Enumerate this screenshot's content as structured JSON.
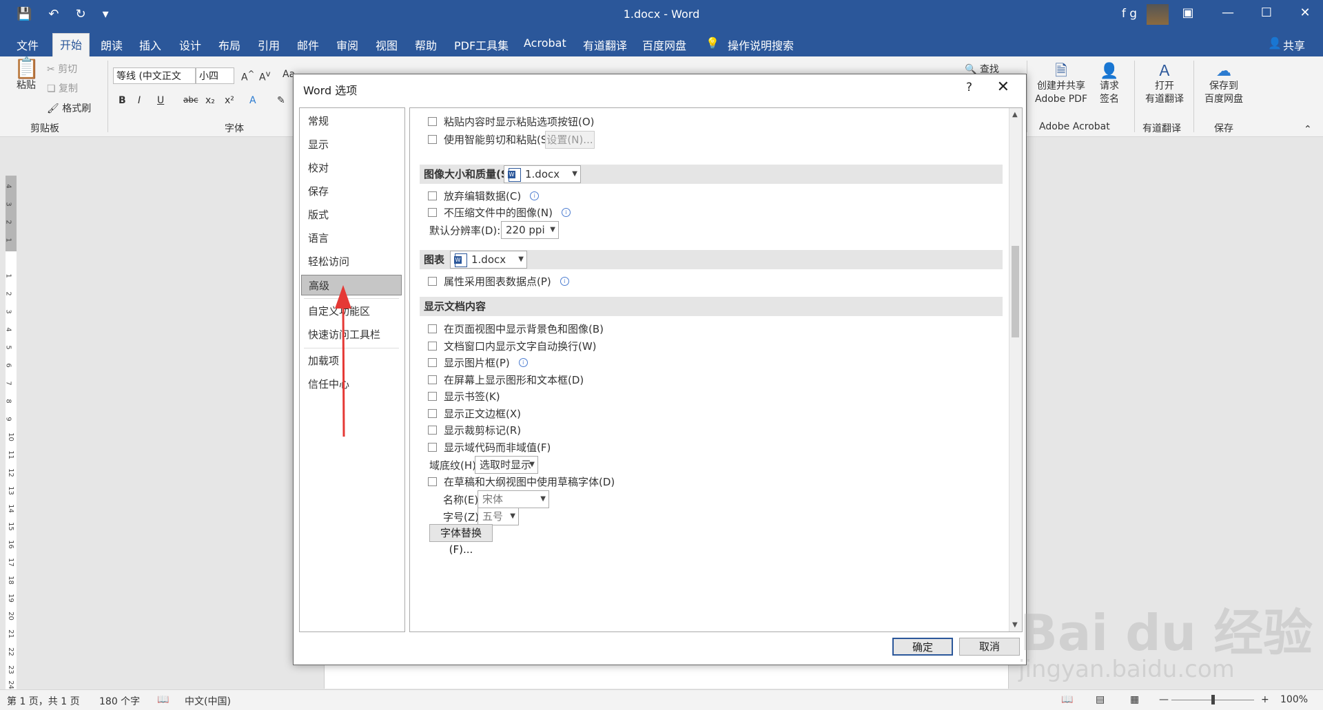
{
  "window": {
    "title": "1.docx - Word",
    "user": "f g"
  },
  "ribbon_tabs": [
    "文件",
    "开始",
    "朗读",
    "插入",
    "设计",
    "布局",
    "引用",
    "邮件",
    "审阅",
    "视图",
    "帮助",
    "PDF工具集",
    "Acrobat",
    "有道翻译",
    "百度网盘",
    "操作说明搜索",
    "共享"
  ],
  "ribbon": {
    "paste": "粘贴",
    "cut": "剪切",
    "copy": "复制",
    "format_painter": "格式刷",
    "clipboard_group": "剪贴板",
    "font_group": "字体",
    "font_name": "等线 (中文正文",
    "font_size": "小四",
    "find": "查找",
    "create_share": "创建并共享",
    "adobe_pdf": "Adobe PDF",
    "request": "请求",
    "sign": "签名",
    "open": "打开",
    "youdao_translate": "有道翻译",
    "save_to": "保存到",
    "baidu_disk": "百度网盘",
    "group_acrobat": "Adobe Acrobat",
    "group_youdao": "有道翻译",
    "group_save": "保存"
  },
  "dialog": {
    "title": "Word 选项",
    "help": "?",
    "nav": [
      "常规",
      "显示",
      "校对",
      "保存",
      "版式",
      "语言",
      "轻松访问",
      "高级",
      "自定义功能区",
      "快速访问工具栏",
      "加载项",
      "信任中心"
    ],
    "selected_nav": "高级",
    "opt_paste_button": "粘贴内容时显示粘贴选项按钮(O)",
    "opt_smart_cut": "使用智能剪切和粘贴(S)",
    "btn_settings": "设置(N)...",
    "sec_image": "图像大小和质量(S)",
    "image_doc": "1.docx",
    "opt_discard_edit": "放弃编辑数据(C)",
    "opt_no_compress": "不压缩文件中的图像(N)",
    "default_resolution_label": "默认分辨率(D):",
    "default_resolution": "220 ppi",
    "sec_chart": "图表",
    "chart_doc": "1.docx",
    "opt_chart_props": "属性采用图表数据点(P)",
    "sec_display": "显示文档内容",
    "opt_bg": "在页面视图中显示背景色和图像(B)",
    "opt_wrap": "文档窗口内显示文字自动换行(W)",
    "opt_picture_frame": "显示图片框(P)",
    "opt_shapes": "在屏幕上显示图形和文本框(D)",
    "opt_bookmarks": "显示书签(K)",
    "opt_text_boundaries": "显示正文边框(X)",
    "opt_crop_marks": "显示裁剪标记(R)",
    "opt_field_codes": "显示域代码而非域值(F)",
    "field_shading_label": "域底纹(H):",
    "field_shading": "选取时显示",
    "opt_draft_font": "在草稿和大纲视图中使用草稿字体(D)",
    "name_label": "名称(E):",
    "name_value": "宋体",
    "size_label": "字号(Z):",
    "size_value": "五号",
    "btn_font_sub": "字体替换(F)...",
    "ok": "确定",
    "cancel": "取消"
  },
  "status": {
    "page": "第 1 页，共 1 页",
    "words": "180 个字",
    "lang": "中文(中国)",
    "zoom": "100%"
  },
  "ruler_numbers": [
    "4",
    "3",
    "2",
    "1",
    "1",
    "2",
    "3",
    "4",
    "5",
    "6",
    "7",
    "8",
    "9",
    "10",
    "11",
    "12",
    "13",
    "14",
    "15",
    "16",
    "17",
    "18",
    "19",
    "20",
    "21",
    "22",
    "23",
    "24"
  ],
  "watermark": {
    "big": "Bai du 经验",
    "small": "jingyan.baidu.com"
  }
}
